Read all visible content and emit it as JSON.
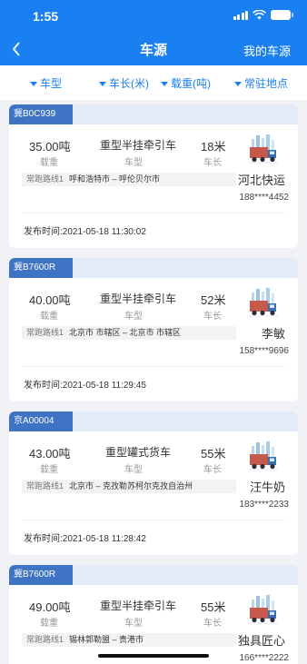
{
  "status": {
    "time": "1:55"
  },
  "header": {
    "back_icon": "chevron-left-icon",
    "title": "车源",
    "right_link": "我的车源"
  },
  "filters": [
    {
      "label": "车型"
    },
    {
      "label": "车长(米)"
    },
    {
      "label": "载重(吨)"
    },
    {
      "label": "常驻地点"
    }
  ],
  "labels": {
    "weight": "载重",
    "vtype": "车型",
    "length": "车长",
    "route_prefix": "常跑路线1",
    "publish_prefix": "发布时间:"
  },
  "listings": [
    {
      "plate": "冀B0C939",
      "weight": "35.00吨",
      "vehicle_type": "重型半挂牵引车",
      "length": "18米",
      "route": "呼和浩特市 – 呼伦贝尔市",
      "owner": "河北快运",
      "phone": "188****4452",
      "published": "2021-05-18 11:30:02"
    },
    {
      "plate": "冀B7600R",
      "weight": "40.00吨",
      "vehicle_type": "重型半挂牵引车",
      "length": "52米",
      "route": "北京市 市辖区 – 北京市 市辖区",
      "owner": "李敏",
      "phone": "158****9696",
      "published": "2021-05-18 11:29:45"
    },
    {
      "plate": "京A00004",
      "weight": "43.00吨",
      "vehicle_type": "重型罐式货车",
      "length": "55米",
      "route": "北京市 – 克孜勒苏柯尔克孜自治州",
      "owner": "汪牛奶",
      "phone": "183****2233",
      "published": "2021-05-18 11:28:42"
    },
    {
      "plate": "冀B7600R",
      "weight": "49.00吨",
      "vehicle_type": "重型半挂牵引车",
      "length": "55米",
      "route": "锡林郭勒盟 – 贵港市",
      "owner": "独具匠心",
      "phone": "166****2222",
      "published": ""
    }
  ]
}
